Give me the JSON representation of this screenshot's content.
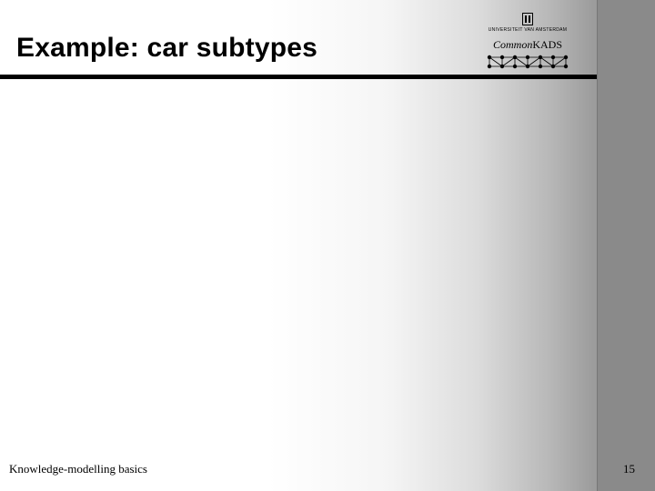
{
  "header": {
    "title": "Example: car subtypes",
    "logos": {
      "uva_label": "UNIVERSITEIT VAN AMSTERDAM",
      "commonkads_italic": "Common",
      "commonkads_roman": "KADS"
    }
  },
  "footer": {
    "left": "Knowledge-modelling basics",
    "page_number": "15"
  }
}
